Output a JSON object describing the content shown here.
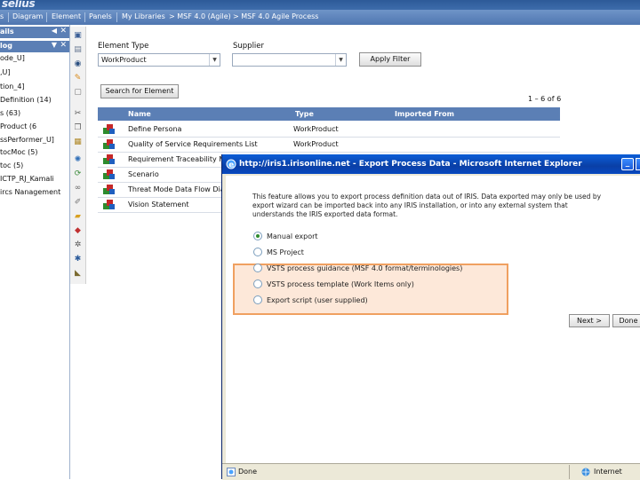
{
  "app": {
    "logo_text": "selius"
  },
  "menu": {
    "items": [
      "s",
      "Diagram",
      "Element",
      "Panels",
      "My Libraries",
      "> MSF 4.0 (Agile)",
      "> MSF 4.0 Agile Process"
    ]
  },
  "left_panel": {
    "header1": "ails",
    "header2": "log",
    "items": [
      "ode_U]",
      ",U]",
      "tion_4]",
      "Definition (14)",
      "s (63)",
      "Product (6",
      "ssPerformer_U]",
      "tocMoc (5)",
      "toc (5)",
      "ICTP_RJ_Kamali",
      "ircs Nanagement"
    ]
  },
  "toolbar_icons": [
    "save-icon",
    "page-icon",
    "eye-icon",
    "pencil-icon",
    "clipboard-icon",
    "scissors-icon",
    "copy-icon",
    "paste-icon",
    "globe-icon",
    "refresh-icon",
    "link-icon",
    "page-edit-icon",
    "folder-icon",
    "stack-icon",
    "gear-icon",
    "person-icon",
    "ruler-icon"
  ],
  "form": {
    "element_type_label": "Element Type",
    "element_type_value": "WorkProduct",
    "supplier_label": "Supplier",
    "supplier_value": "",
    "apply_filter_button": "Apply Filter",
    "search_button": "Search for Element",
    "pagination": "1 – 6 of 6"
  },
  "table": {
    "headers": {
      "name": "Name",
      "type": "Type",
      "imported_from": "Imported From"
    },
    "rows": [
      {
        "name": "Define Persona",
        "type": "WorkProduct"
      },
      {
        "name": "Quality of Service Requirements List",
        "type": "WorkProduct"
      },
      {
        "name": "Requirement Traceability M",
        "type": ""
      },
      {
        "name": "Scenario",
        "type": ""
      },
      {
        "name": "Threat Mode Data Flow Dia",
        "type": ""
      },
      {
        "name": "Vision Statement",
        "type": ""
      }
    ]
  },
  "popup": {
    "title": "http://iris1.irisonline.net - Export Process Data - Microsoft Internet Explorer",
    "description": [
      "This feature allows you to export process definition data out of IRIS. Data exported may only be used by",
      "export wizard can be imported back into any IRIS installation, or into any external system that",
      "understands the IRIS exported data format."
    ],
    "options": [
      {
        "label": "Manual export",
        "selected": true
      },
      {
        "label": "MS Project",
        "selected": false
      },
      {
        "label": "VSTS process guidance (MSF 4.0 format/terminologies)",
        "selected": false
      },
      {
        "label": "VSTS process template (Work Items only)",
        "selected": false
      },
      {
        "label": "Export script (user supplied)",
        "selected": false
      }
    ],
    "next_button": "Next >",
    "done_button": "Done",
    "status_text": "Done",
    "status_zone": "Internet"
  },
  "colors": {
    "banner": "#3d6cab",
    "menubar": "#5f86be",
    "panel_header": "#5b7fb5",
    "xp_title": "#0a54d0",
    "highlight_border": "#f0a060"
  }
}
